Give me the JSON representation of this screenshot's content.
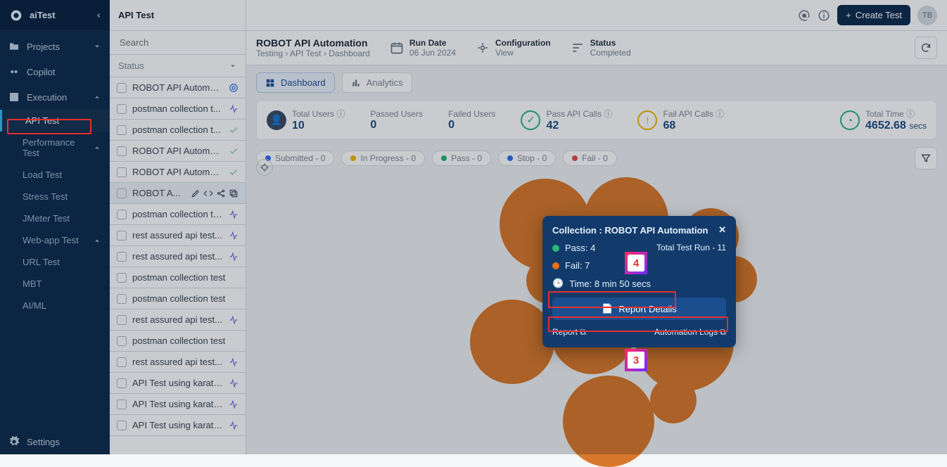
{
  "brand": {
    "name": "aiTest"
  },
  "sidebar": {
    "projects": "Projects",
    "copilot": "Copilot",
    "execution": "Execution",
    "execution_children": [
      {
        "label": "API Test",
        "active": true
      },
      {
        "label": "Performance Test",
        "expandable": true
      },
      {
        "label": "Load Test"
      },
      {
        "label": "Stress Test"
      },
      {
        "label": "JMeter Test"
      },
      {
        "label": "Web-app Test",
        "expandable": true
      },
      {
        "label": "URL Test"
      },
      {
        "label": "MBT"
      },
      {
        "label": "AI/ML"
      }
    ],
    "settings": "Settings"
  },
  "list_panel": {
    "title": "API Test",
    "search_placeholder": "Search",
    "status_label": "Status",
    "items": [
      {
        "label": "ROBOT API Automati...",
        "status": "stop"
      },
      {
        "label": "postman collection t...",
        "status": "running"
      },
      {
        "label": "postman collection t...",
        "status": "pass"
      },
      {
        "label": "ROBOT API Automati...",
        "status": "pass"
      },
      {
        "label": "ROBOT API Automati...",
        "status": "pass"
      },
      {
        "label": "ROBOT A...",
        "status": "selected"
      },
      {
        "label": "postman collection test",
        "status": "running"
      },
      {
        "label": "rest assured api test...",
        "status": "running"
      },
      {
        "label": "rest assured api test...",
        "status": "running"
      },
      {
        "label": "postman collection test",
        "status": "none"
      },
      {
        "label": "postman collection test",
        "status": "none"
      },
      {
        "label": "rest assured api test...",
        "status": "running"
      },
      {
        "label": "postman collection test",
        "status": "none"
      },
      {
        "label": "rest assured api test...",
        "status": "running"
      },
      {
        "label": "API Test using karate...",
        "status": "running"
      },
      {
        "label": "API Test using karate...",
        "status": "running"
      },
      {
        "label": "API Test using karate...",
        "status": "running"
      }
    ]
  },
  "header": {
    "title": "ROBOT API Automation",
    "breadcrumbs": [
      "Testing",
      "API Test",
      "Dashboard"
    ],
    "run_date_label": "Run Date",
    "run_date_value": "06 Jun 2024",
    "config_label": "Configuration",
    "config_value": "View",
    "status_label": "Status",
    "status_value": "Completed"
  },
  "topbar": {
    "create_label": "Create Test",
    "avatar_initials": "TB"
  },
  "tabs": {
    "dashboard": "Dashboard",
    "analytics": "Analytics"
  },
  "stats": {
    "total_users": {
      "label": "Total Users",
      "value": "10"
    },
    "passed_users": {
      "label": "Passed Users",
      "value": "0"
    },
    "failed_users": {
      "label": "Failed Users",
      "value": "0"
    },
    "pass_api": {
      "label": "Pass API Calls",
      "value": "42"
    },
    "fail_api": {
      "label": "Fail API Calls",
      "value": "68"
    },
    "total_time": {
      "label": "Total Time",
      "value": "4652.68",
      "unit": "secs"
    }
  },
  "pills": {
    "submitted": "Submitted - 0",
    "inprogress": "In Progress - 0",
    "pass": "Pass - 0",
    "stop": "Stop - 0",
    "fail": "Fail - 0"
  },
  "popover": {
    "title": "Collection : ROBOT API Automation",
    "pass": "Pass: 4",
    "fail": "Fail: 7",
    "time": "Time: 8 min 50 secs",
    "total_run": "Total Test Run - 11",
    "report_details": "Report Details",
    "report": "Report",
    "automation_logs": "Automation Logs"
  },
  "callouts": {
    "c3": "3",
    "c4": "4"
  }
}
